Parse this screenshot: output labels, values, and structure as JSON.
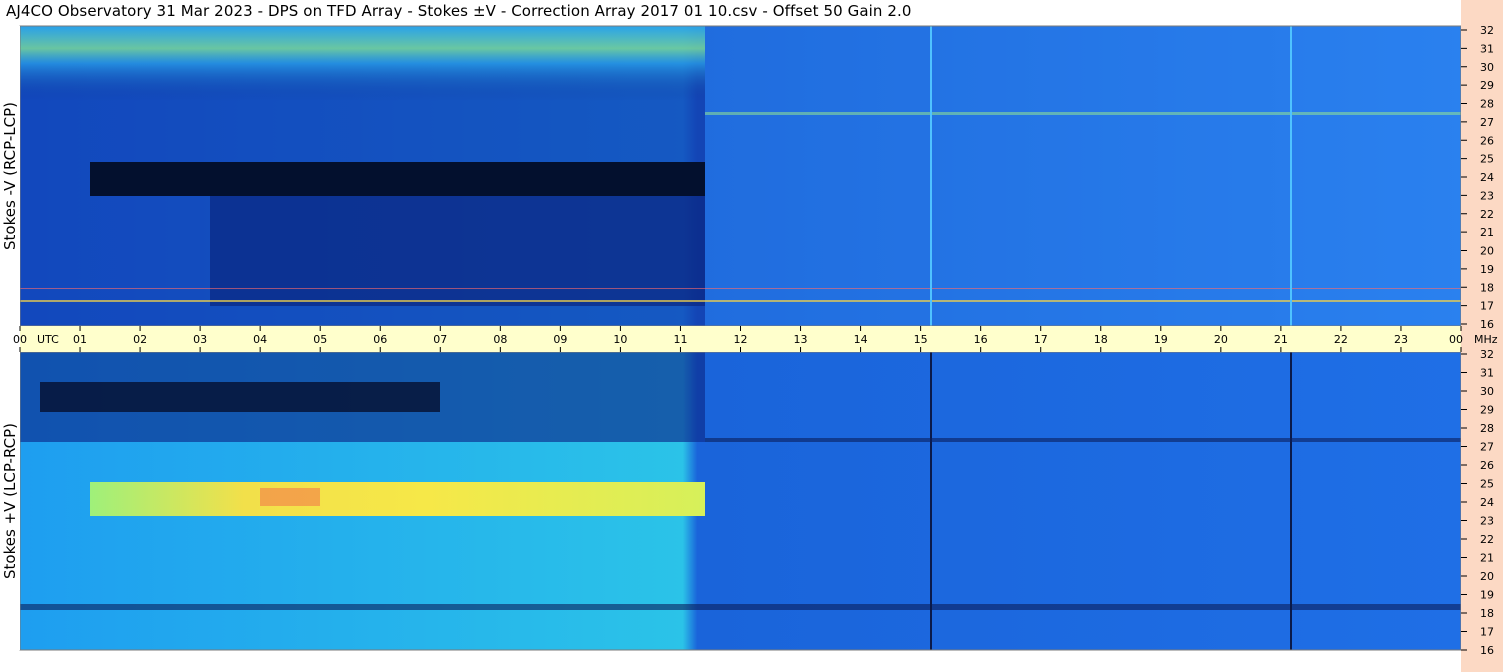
{
  "title": "AJ4CO Observatory  31 Mar 2023  -  DPS on TFD Array  -  Stokes ±V  -  Correction Array 2017 01 10.csv  -  Offset 50  Gain 2.0",
  "colors": {
    "band": "#ffffcc",
    "rightStrip": "#fcd9c4",
    "frame": "#8a8a8a"
  },
  "chart_data": {
    "type": "heatmap",
    "x_ticks": [
      "00",
      "01",
      "02",
      "03",
      "04",
      "05",
      "06",
      "07",
      "08",
      "09",
      "10",
      "11",
      "12",
      "13",
      "14",
      "15",
      "16",
      "17",
      "18",
      "19",
      "20",
      "21",
      "22",
      "23",
      "00"
    ],
    "x_unit_label": "UTC",
    "y_ticks": [
      32,
      31,
      30,
      29,
      28,
      27,
      26,
      25,
      24,
      23,
      22,
      21,
      20,
      19,
      18,
      17,
      16
    ],
    "y_unit_label": "MHz",
    "xlim_hours": [
      0,
      24
    ],
    "ylim_mhz": [
      16,
      32
    ],
    "panels": [
      {
        "label": "Stokes -V (RCP-LCP)"
      },
      {
        "label": "Stokes +V (LCP-RCP)"
      }
    ]
  }
}
